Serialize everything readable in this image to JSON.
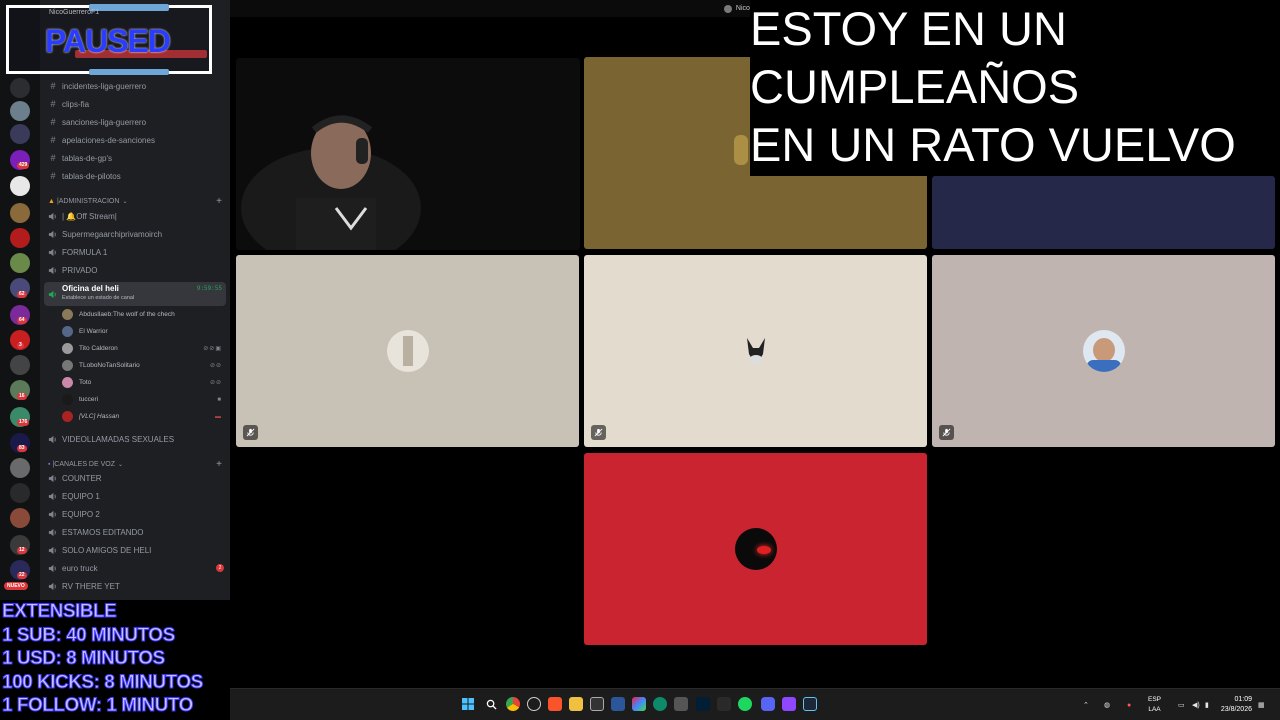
{
  "window": {
    "title": "NicoGuerreroF1"
  },
  "paused_overlay": {
    "text": "PAUSED",
    "ghost_text": "NicoGuerreroF1"
  },
  "stream_message": {
    "lines": [
      "ESTOY EN UN",
      "CUMPLEAÑOS",
      "EN UN RATO VUELVO"
    ]
  },
  "extensible": {
    "lines": [
      "EXTENSIBLE",
      "1 SUB: 40 MINUTOS",
      "1 USD: 8 MINUTOS",
      "100 KICKS: 8 MINUTOS",
      "1 FOLLOW: 1 MINUTO"
    ]
  },
  "guild_rail": {
    "badges": [
      "429",
      "62",
      "64",
      "3",
      "16",
      "176",
      "83",
      "12",
      "22"
    ],
    "new_label": "NUEVO"
  },
  "channels_top": [
    {
      "name": "incidentes-liga-guerrero"
    },
    {
      "name": "clips-fia"
    },
    {
      "name": "sanciones-liga-guerrero"
    },
    {
      "name": "apelaciones-de-sanciones"
    },
    {
      "name": "tablas-de-gp's"
    },
    {
      "name": "tablas-de-pilotos"
    }
  ],
  "category_admin": {
    "label": "|ADMINISTRACION"
  },
  "admin_channels": [
    {
      "name": "| 🔔Off Stream|"
    },
    {
      "name": "Supermegaarchiprivamoirch"
    },
    {
      "name": "FORMULA 1"
    },
    {
      "name": "PRIVADO"
    }
  ],
  "active_channel": {
    "name": "Oficina del heli",
    "status": "Establece un estado de canal",
    "timer": "9:59:55",
    "users": [
      {
        "name": "Abdusllaeb:The wolf of the chech",
        "color": "#8a7a5a"
      },
      {
        "name": "El Warrior",
        "color": "#556688"
      },
      {
        "name": "Tito Calderon",
        "color": "#9a9a9a"
      },
      {
        "name": "TLoboNoTanSolitario",
        "color": "#777"
      },
      {
        "name": "Toto",
        "color": "#c8a"
      },
      {
        "name": "tucceri",
        "color": "#1a1a1a"
      },
      {
        "name": "[VLC] Hassan",
        "color": "#aa2222"
      }
    ]
  },
  "after_active": {
    "name": "VIDEOLLAMADAS SEXUALES"
  },
  "category_voice": {
    "label": "|CANALES DE VOZ"
  },
  "voice_channels": [
    {
      "name": "COUNTER"
    },
    {
      "name": "EQUIPO 1"
    },
    {
      "name": "EQUIPO 2"
    },
    {
      "name": "ESTAMOS EDITANDO"
    },
    {
      "name": "SOLO AMIGOS DE HELI"
    },
    {
      "name": "euro truck",
      "badge": "2"
    },
    {
      "name": "RV THERE YET"
    }
  ],
  "tiles": [
    {
      "bg": "#7a6432"
    },
    {
      "bg": "#26284a"
    },
    {
      "bg": "#c8c2b6",
      "avatar": "#d8d2c8"
    },
    {
      "bg": "#e3dbce",
      "avatar": "#222"
    },
    {
      "bg": "#c0b4b1",
      "avatar": "#3a6fbf"
    },
    {
      "bg": "#cb2431",
      "avatar": "#0a0a0a"
    }
  ],
  "taskbar": {
    "lang_top": "ESP",
    "lang_bottom": "LAA",
    "time": "01:09",
    "date": "23/8/2026"
  }
}
